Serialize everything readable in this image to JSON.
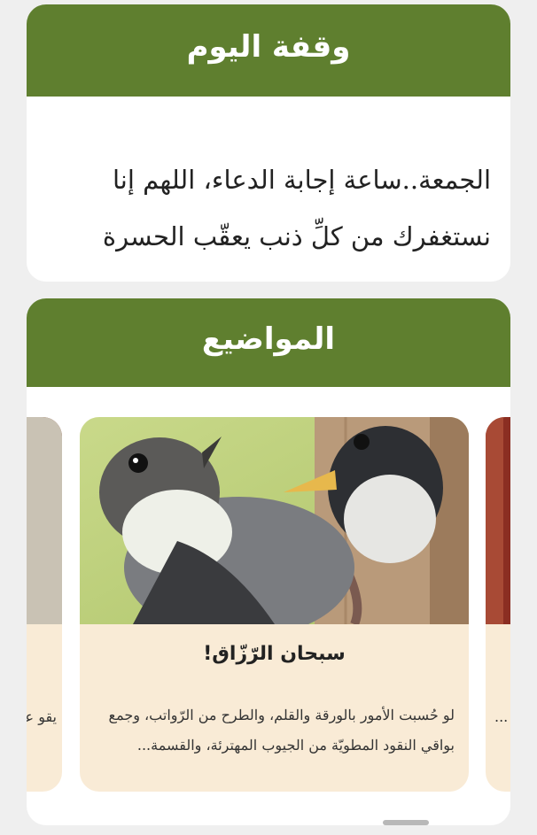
{
  "daily": {
    "title": "وقفة اليوم",
    "text": "الجمعة..ساعة إجابة الدعاء، اللهم إنا نستغفرك من كلِّ ذنب يعقّب الحسرة ويُورث الندامة.."
  },
  "topics": {
    "title": "المواضيع",
    "prev_card": {
      "text": "يقو علي"
    },
    "main_card": {
      "title": "سبحان الرّزّاق!",
      "excerpt": "لو حُسبت الأمور بالورقة والقلم، والطرح من الرّواتب، وجمع بواقي النقود المطويّة من الجيوب المهترئة، والقسمة..."
    },
    "next_card": {
      "text": "..."
    }
  }
}
